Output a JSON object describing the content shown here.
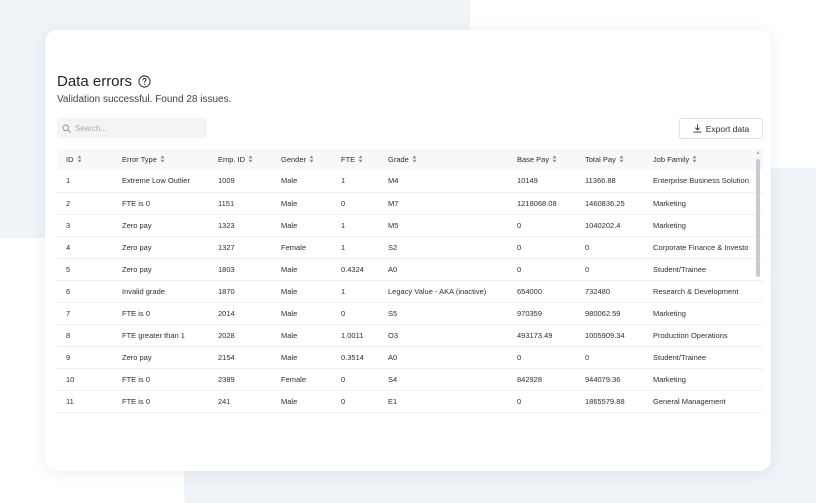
{
  "header": {
    "title": "Data errors",
    "subtitle": "Validation successful. Found 28 issues."
  },
  "search": {
    "placeholder": "Search...",
    "value": ""
  },
  "toolbar": {
    "export_label": "Export data"
  },
  "table": {
    "columns": [
      "ID",
      "Error Type",
      "Emp. ID",
      "Gender",
      "FTE",
      "Grade",
      "Base Pay",
      "Total Pay",
      "Job Family"
    ],
    "rows": [
      [
        "1",
        "Extreme Low Outlier",
        "1009",
        "Male",
        "1",
        "M4",
        "10149",
        "11366.88",
        "Enterprise Business Solution"
      ],
      [
        "2",
        "FTE is 0",
        "1151",
        "Male",
        "0",
        "M7",
        "1218068.08",
        "1460836.25",
        "Marketing"
      ],
      [
        "3",
        "Zero pay",
        "1323",
        "Male",
        "1",
        "M5",
        "0",
        "1040202.4",
        "Marketing"
      ],
      [
        "4",
        "Zero pay",
        "1327",
        "Female",
        "1",
        "S2",
        "0",
        "0",
        "Corporate Finance & Investo"
      ],
      [
        "5",
        "Zero pay",
        "1803",
        "Male",
        "0.4324",
        "A0",
        "0",
        "0",
        "Student/Trainee"
      ],
      [
        "6",
        "Invalid grade",
        "1870",
        "Male",
        "1",
        "Legacy Value - AKA (inactive)",
        "654000",
        "732480",
        "Research & Development"
      ],
      [
        "7",
        "FTE is 0",
        "2014",
        "Male",
        "0",
        "S5",
        "970359",
        "980062.59",
        "Marketing"
      ],
      [
        "8",
        "FTE greater than 1",
        "2028",
        "Male",
        "1.0011",
        "O3",
        "493173.49",
        "1005909.34",
        "Production Operations"
      ],
      [
        "9",
        "Zero pay",
        "2154",
        "Male",
        "0.3514",
        "A0",
        "0",
        "0",
        "Student/Trainee"
      ],
      [
        "10",
        "FTE is 0",
        "2389",
        "Female",
        "0",
        "S4",
        "842928",
        "944079.36",
        "Marketing"
      ],
      [
        "11",
        "FTE is 0",
        "241",
        "Male",
        "0",
        "E1",
        "0",
        "1865579.88",
        "General Management"
      ]
    ]
  },
  "icons": {
    "help": "help-circle-icon",
    "search": "search-icon",
    "export": "download-icon",
    "sort": "sort-icon"
  },
  "colors": {
    "background_shape": "#eef4f8",
    "header_row": "#f7f8fa",
    "search_field": "#f3f4f6"
  }
}
